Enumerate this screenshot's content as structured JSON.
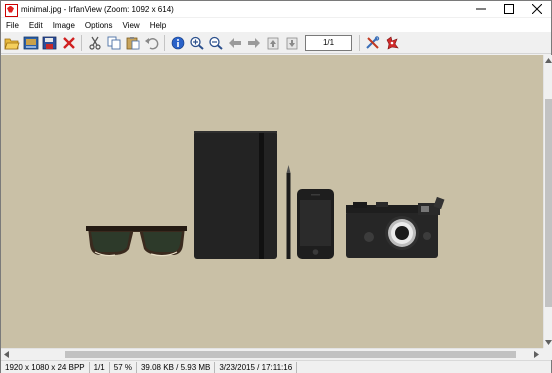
{
  "window": {
    "title": "minimal.jpg - IrfanView (Zoom: 1092 x 614)"
  },
  "menu": [
    "File",
    "Edit",
    "Image",
    "Options",
    "View",
    "Help"
  ],
  "toolbar": {
    "page_indicator": "1/1",
    "buttons": [
      "open-icon",
      "slideshow-icon",
      "save-icon",
      "delete-icon",
      "cut-icon",
      "copy-icon",
      "paste-icon",
      "undo-icon",
      "info-icon",
      "zoom-in-icon",
      "zoom-out-icon",
      "previous-icon",
      "next-icon",
      "first-page-icon",
      "last-page-icon",
      "settings-icon",
      "irfanview-logo-icon"
    ]
  },
  "status": {
    "resolution": "1920 x 1080 x 24 BPP",
    "page": "1/1",
    "zoom": "57 %",
    "filesize": "39.08 KB / 5.93 MB",
    "datetime": "3/23/2015 / 17:11:16"
  },
  "colors": {
    "canvas_background": "#c9c0a6",
    "object_dark": "#222222"
  },
  "image_content": [
    "sunglasses",
    "notebook",
    "pencil",
    "smartphone",
    "camera"
  ]
}
